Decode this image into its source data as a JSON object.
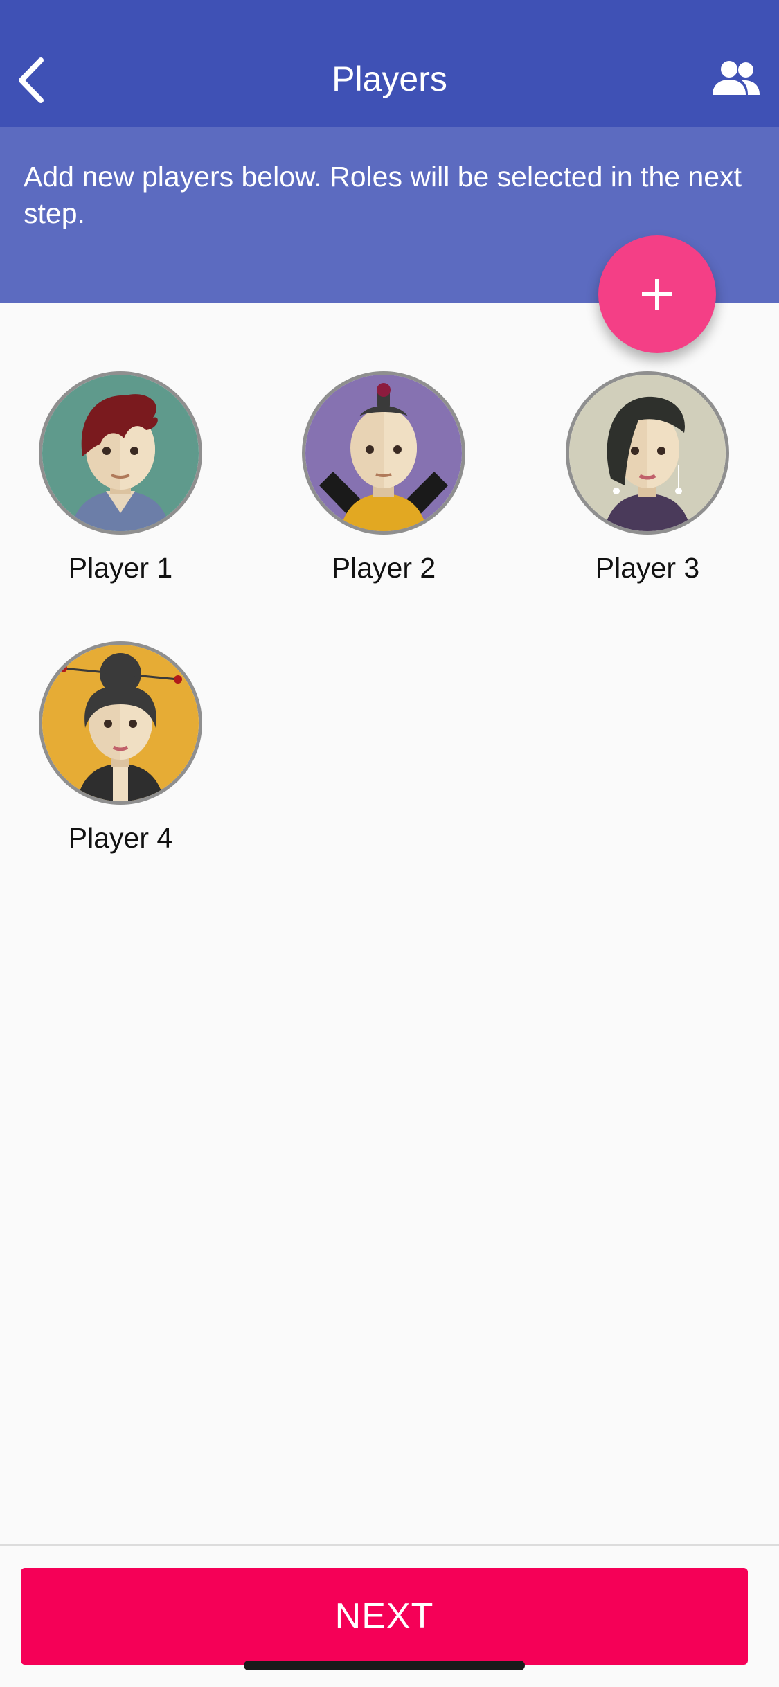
{
  "header": {
    "title": "Players",
    "back_icon": "chevron-left-icon",
    "action_icon": "people-icon",
    "background": "#3f51b5"
  },
  "banner": {
    "text": "Add new players below. Roles will be selected in the next step.",
    "background": "#5c6bc0"
  },
  "fab": {
    "label": "+",
    "icon": "plus-icon",
    "color": "#f43f86"
  },
  "players": [
    {
      "name": "Player 1",
      "avatar": "red-haired-man-avatar"
    },
    {
      "name": "Player 2",
      "avatar": "topknot-man-avatar"
    },
    {
      "name": "Player 3",
      "avatar": "dark-haired-woman-avatar"
    },
    {
      "name": "Player 4",
      "avatar": "bun-haired-woman-avatar"
    }
  ],
  "footer": {
    "next_label": "NEXT",
    "color": "#f50057"
  }
}
